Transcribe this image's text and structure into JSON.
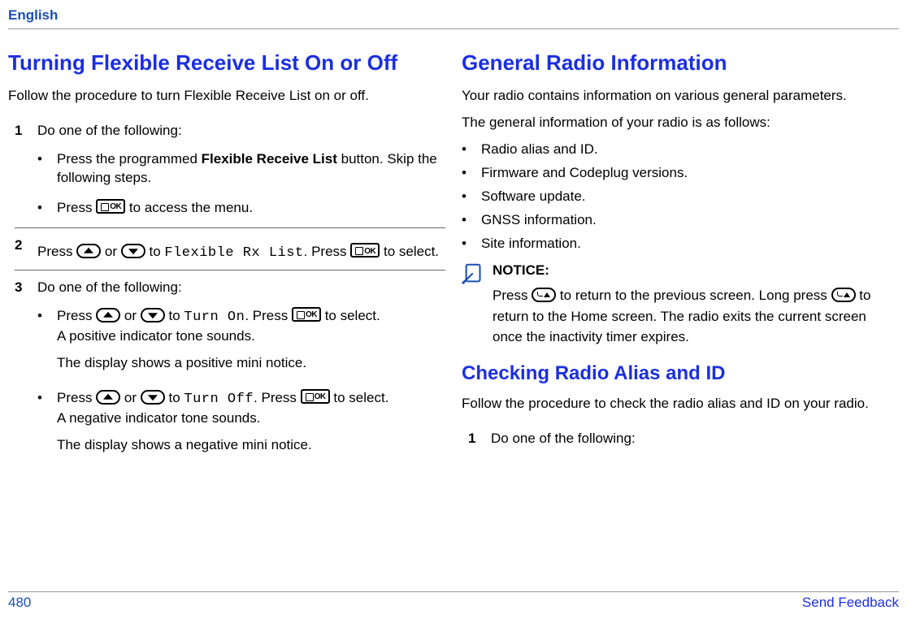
{
  "header": {
    "language": "English"
  },
  "footer": {
    "pageNum": "480",
    "feedback": "Send Feedback"
  },
  "left": {
    "title": "Turning Flexible Receive List On or Off",
    "intro": "Follow the procedure to turn Flexible Receive List on or off.",
    "step1": {
      "num": "1",
      "lead": "Do one of the following:",
      "b1_a": "Press the programmed ",
      "b1_bold": "Flexible Receive List",
      "b1_b": " button. Skip the following steps.",
      "b2_a": "Press ",
      "b2_b": " to access the menu."
    },
    "step2": {
      "num": "2",
      "a": "Press ",
      "b": " or ",
      "c": " to ",
      "mono": "Flexible Rx List",
      "d": ". Press ",
      "e": " to select."
    },
    "step3": {
      "num": "3",
      "lead": "Do one of the following:",
      "b1_a": "Press ",
      "b1_b": " or ",
      "b1_c": " to ",
      "b1_mono": "Turn On",
      "b1_d": ". Press ",
      "b1_e": " to select.",
      "b1_f": "A positive indicator tone sounds.",
      "b1_g": "The display shows a positive mini notice.",
      "b2_a": "Press ",
      "b2_b": " or ",
      "b2_c": " to ",
      "b2_mono": "Turn Off",
      "b2_d": ". Press ",
      "b2_e": " to select.",
      "b2_f": "A negative indicator tone sounds.",
      "b2_g": "The display shows a negative mini notice."
    }
  },
  "right": {
    "title": "General Radio Information",
    "p1": "Your radio contains information on various general parameters.",
    "p2": "The general information of your radio is as follows:",
    "items": {
      "i0": "Radio alias and ID.",
      "i1": "Firmware and Codeplug versions.",
      "i2": "Software update.",
      "i3": "GNSS information.",
      "i4": "Site information."
    },
    "notice": {
      "label": "NOTICE:",
      "a": "Press ",
      "b": " to return to the previous screen. Long press ",
      "c": " to return to the Home screen. The radio exits the current screen once the inactivity timer expires."
    },
    "sub": {
      "title": "Checking Radio Alias and ID",
      "intro": "Follow the procedure to check the radio alias and ID on your radio.",
      "step1_num": "1",
      "step1_text": "Do one of the following:"
    }
  }
}
